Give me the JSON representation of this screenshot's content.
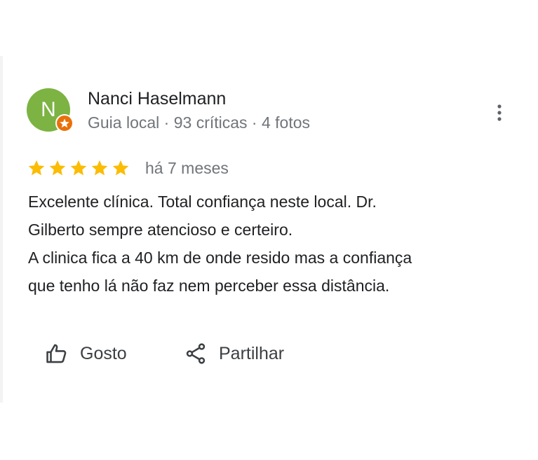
{
  "review": {
    "author": {
      "initial": "N",
      "name": "Nanci Haselmann",
      "meta": "Guia local · 93 críticas · 4 fotos",
      "avatar_color": "#7cb342",
      "badge_color": "#e8710a",
      "badge_icon": "local-guide-star-icon"
    },
    "rating": 5,
    "rating_max": 5,
    "star_color": "#fbbc04",
    "date": "há 7 meses",
    "text_lines": [
      "Excelente clínica. Total confiança neste local. Dr.",
      "Gilberto sempre atencioso e certeiro.",
      "A clinica fica a 40 km de onde resido mas a confiança",
      "que tenho lá não faz nem perceber essa distância."
    ],
    "actions": {
      "like_label": "Gosto",
      "like_icon": "thumbs-up-icon",
      "share_label": "Partilhar",
      "share_icon": "share-icon"
    },
    "more_icon": "more-vertical-icon"
  }
}
